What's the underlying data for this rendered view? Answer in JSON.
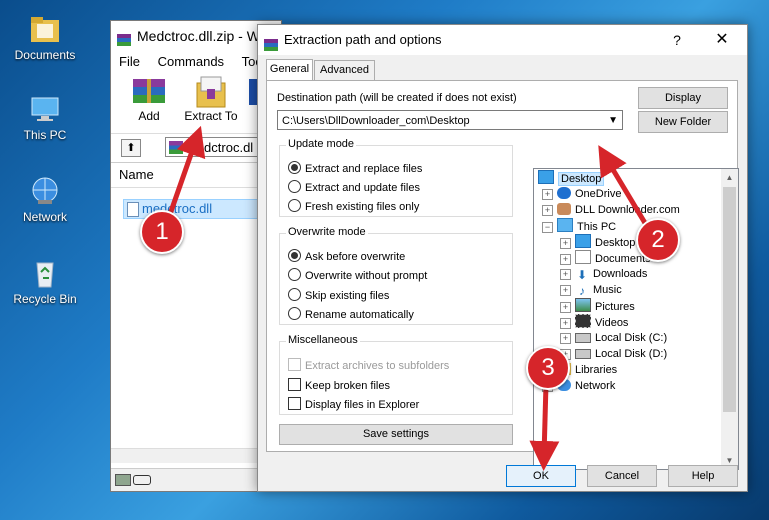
{
  "colors": {
    "marker": "#d6252a",
    "selection": "#cce8ff",
    "selection_border": "#99d1ff"
  },
  "desktop": {
    "icons": [
      {
        "label": "Documents",
        "icon": "folder-icon"
      },
      {
        "label": "This PC",
        "icon": "computer-icon"
      },
      {
        "label": "Network",
        "icon": "network-icon"
      },
      {
        "label": "Recycle Bin",
        "icon": "recycle-bin-icon"
      }
    ]
  },
  "winrar": {
    "title": "Medctroc.dll.zip - Wi",
    "menu": [
      "File",
      "Commands",
      "Tools"
    ],
    "toolbar": {
      "add": "Add",
      "extract_to": "Extract To",
      "third": "T"
    },
    "address": "Medctroc.dl",
    "column_name": "Name",
    "file": "medctroc.dll"
  },
  "dialog": {
    "title": "Extraction path and options",
    "help_glyph": "?",
    "close_glyph": "✕",
    "tabs": [
      "General",
      "Advanced"
    ],
    "dest_label": "Destination path (will be created if does not exist)",
    "dest_value": "C:\\Users\\DllDownloader_com\\Desktop",
    "display_button": "Display",
    "new_folder_button": "New Folder",
    "update_mode": {
      "title": "Update mode",
      "options": [
        "Extract and replace files",
        "Extract and update files",
        "Fresh existing files only"
      ],
      "selected": 0
    },
    "overwrite_mode": {
      "title": "Overwrite mode",
      "options": [
        "Ask before overwrite",
        "Overwrite without prompt",
        "Skip existing files",
        "Rename automatically"
      ],
      "selected": 0
    },
    "misc": {
      "title": "Miscellaneous",
      "options": [
        "Extract archives to subfolders",
        "Keep broken files",
        "Display files in Explorer"
      ]
    },
    "save_settings": "Save settings",
    "tree": [
      {
        "label": "Desktop",
        "icon": "desktop-icon"
      },
      {
        "label": "OneDrive",
        "icon": "onedrive-icon"
      },
      {
        "label": "DLL Downloader.com",
        "icon": "user-icon"
      },
      {
        "label": "This PC",
        "icon": "computer-icon"
      },
      {
        "label": "Desktop",
        "icon": "desktop-icon"
      },
      {
        "label": "Documents",
        "icon": "documents-icon"
      },
      {
        "label": "Downloads",
        "icon": "downloads-icon"
      },
      {
        "label": "Music",
        "icon": "music-icon"
      },
      {
        "label": "Pictures",
        "icon": "pictures-icon"
      },
      {
        "label": "Videos",
        "icon": "videos-icon"
      },
      {
        "label": "Local Disk (C:)",
        "icon": "drive-icon"
      },
      {
        "label": "Local Disk (D:)",
        "icon": "drive-icon"
      },
      {
        "label": "Libraries",
        "icon": "folder-icon"
      },
      {
        "label": "Network",
        "icon": "network-icon"
      }
    ],
    "ok": "OK",
    "cancel": "Cancel",
    "help": "Help"
  },
  "markers": [
    "1",
    "2",
    "3"
  ]
}
